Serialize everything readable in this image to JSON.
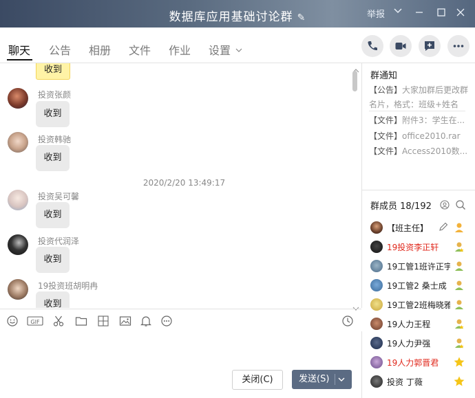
{
  "window": {
    "title": "数据库应用基础讨论群",
    "report_label": "举报"
  },
  "tabs": [
    {
      "label": "聊天"
    },
    {
      "label": "公告"
    },
    {
      "label": "相册"
    },
    {
      "label": "文件"
    },
    {
      "label": "作业"
    },
    {
      "label": "设置"
    }
  ],
  "chat": {
    "messages": [
      {
        "sender": "",
        "text": "收到"
      },
      {
        "sender": "投资张颜",
        "text": "收到"
      },
      {
        "sender": "投资韩驰",
        "text": "收到"
      },
      {
        "sender": "投资吴可馨",
        "text": "收到"
      },
      {
        "sender": "投资代润泽",
        "text": "收到"
      },
      {
        "sender": "19投资班胡明冉",
        "text": "收到"
      }
    ],
    "timestamp": "2020/2/20 13:49:17"
  },
  "buttons": {
    "close": "关闭(C)",
    "send": "发送(S)"
  },
  "sidebar": {
    "notice_title": "群通知",
    "notices": [
      {
        "tag": "【公告】",
        "text": "大家加群后更改群"
      },
      {
        "tag": "",
        "text": "名片，格式：班级+姓名"
      },
      {
        "tag": "【文件】",
        "text": "附件3：学生在..."
      },
      {
        "tag": "【文件】",
        "text": "office2010.rar"
      },
      {
        "tag": "【文件】",
        "text": "Access2010数..."
      }
    ],
    "members_title": "群成员 18/192",
    "members": [
      {
        "name": "【班主任】",
        "red": false
      },
      {
        "name": "19投资李正轩",
        "red": true
      },
      {
        "name": "19工管1班许正宇",
        "red": false
      },
      {
        "name": "19工管2 桑士成",
        "red": false
      },
      {
        "name": "19工管2班梅晓雅",
        "red": false
      },
      {
        "name": "19人力王程",
        "red": false
      },
      {
        "name": "19人力尹强",
        "red": false
      },
      {
        "name": "19人力郭晋君",
        "red": true
      },
      {
        "name": "投资     丁薇",
        "red": false
      }
    ]
  },
  "colors": {
    "accent_red": "#e0271b",
    "send_button": "#5b6b83"
  }
}
